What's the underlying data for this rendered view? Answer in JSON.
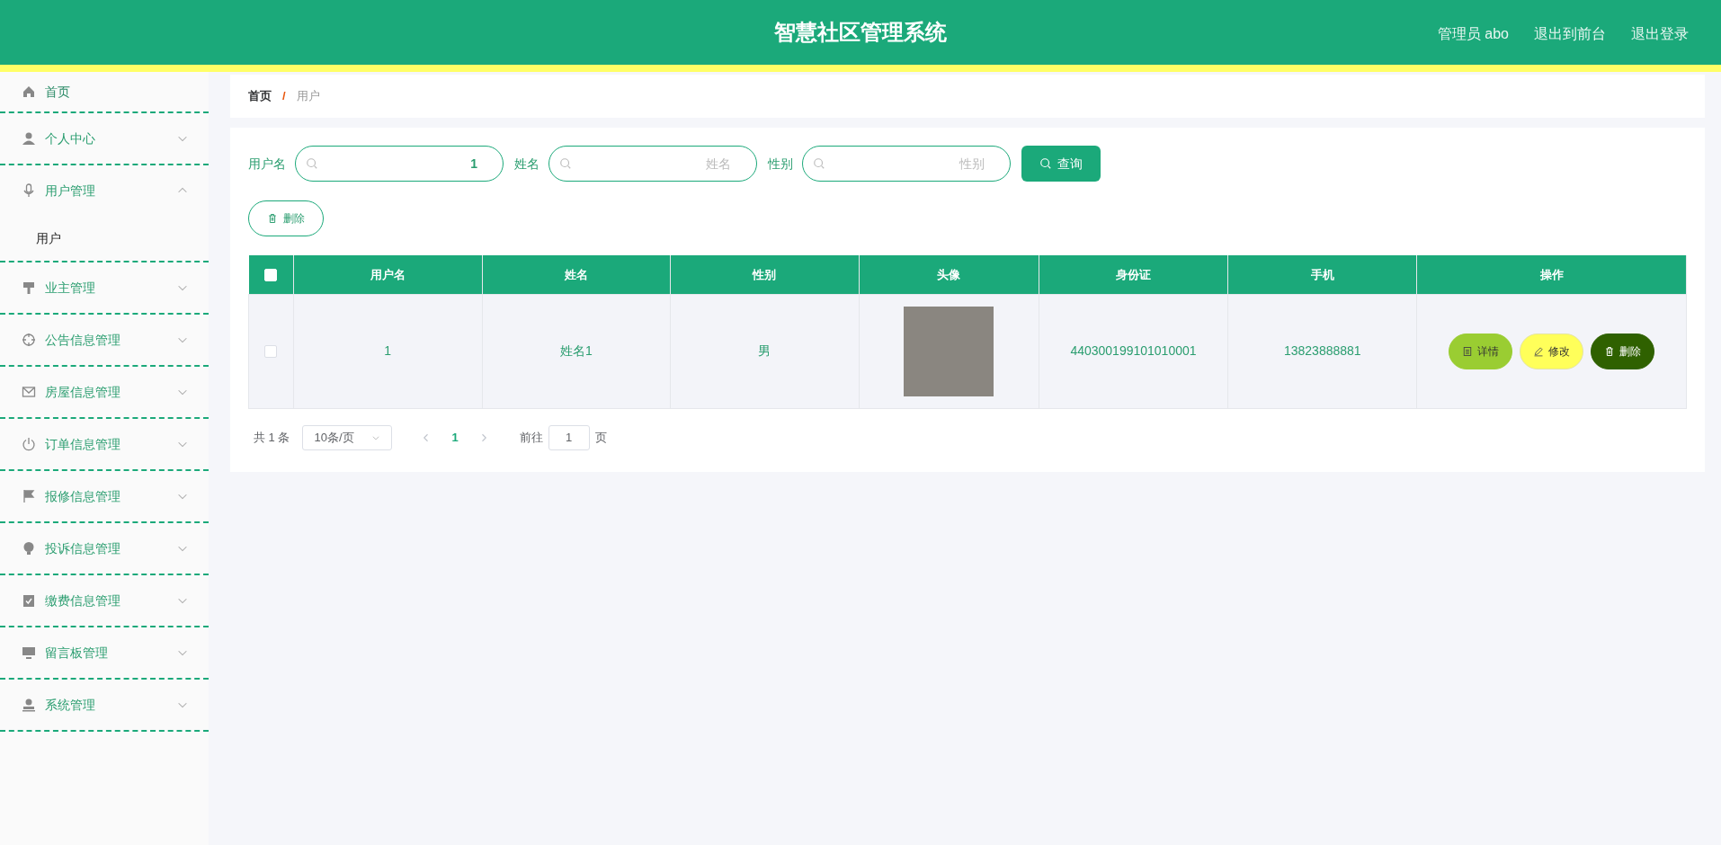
{
  "header": {
    "title": "智慧社区管理系统",
    "links": [
      "管理员 abo",
      "退出到前台",
      "退出登录"
    ]
  },
  "sidebar": {
    "items": [
      {
        "kind": "link",
        "label": "首页"
      },
      {
        "kind": "menu",
        "label": "个人中心",
        "expanded": false
      },
      {
        "kind": "menu",
        "label": "用户管理",
        "expanded": true,
        "children": [
          {
            "label": "用户"
          }
        ]
      },
      {
        "kind": "menu",
        "label": "业主管理",
        "expanded": false
      },
      {
        "kind": "menu",
        "label": "公告信息管理",
        "expanded": false
      },
      {
        "kind": "menu",
        "label": "房屋信息管理",
        "expanded": false
      },
      {
        "kind": "menu",
        "label": "订单信息管理",
        "expanded": false
      },
      {
        "kind": "menu",
        "label": "报修信息管理",
        "expanded": false
      },
      {
        "kind": "menu",
        "label": "投诉信息管理",
        "expanded": false
      },
      {
        "kind": "menu",
        "label": "缴费信息管理",
        "expanded": false
      },
      {
        "kind": "menu",
        "label": "留言板管理",
        "expanded": false
      },
      {
        "kind": "menu",
        "label": "系统管理",
        "expanded": false
      }
    ]
  },
  "breadcrumb": {
    "items": [
      "首页",
      "用户"
    ],
    "separator": "/"
  },
  "search": {
    "fields": [
      {
        "label": "用户名",
        "value": "1"
      },
      {
        "label": "姓名",
        "placeholder": "姓名"
      },
      {
        "label": "性别",
        "placeholder": "性别"
      }
    ],
    "button": "查询"
  },
  "delete_button": "删除",
  "table": {
    "select_all": false,
    "columns": [
      "用户名",
      "姓名",
      "性别",
      "头像",
      "身份证",
      "手机",
      "操作"
    ],
    "rows": [
      {
        "selected": false,
        "cells": [
          "1",
          "姓名1",
          "男",
          "",
          "440300199101010001",
          "13823888881"
        ],
        "actions": [
          "详情",
          "修改",
          "删除"
        ]
      }
    ]
  },
  "pagination": {
    "total": "共 1 条",
    "page_size": "10条/页",
    "pages": [
      {
        "label": "1",
        "selected": true
      }
    ],
    "goto_label": "前往",
    "goto_value": "1",
    "page_suffix": "页"
  }
}
